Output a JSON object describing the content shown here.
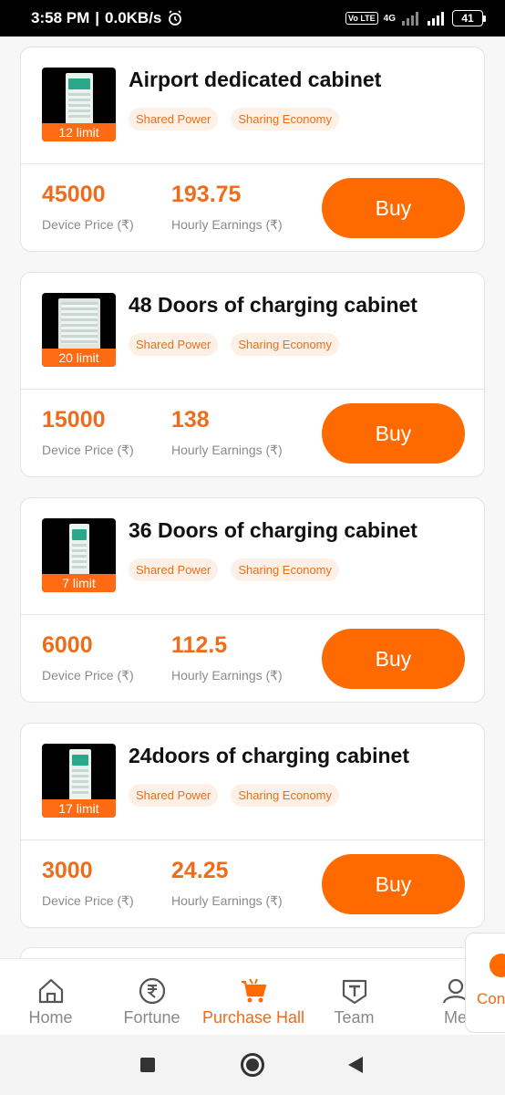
{
  "status_bar": {
    "time": "3:58 PM",
    "net_speed": "0.0KB/s",
    "volte": "Vo LTE",
    "network": "4G",
    "battery": "41"
  },
  "products": [
    {
      "limit": "12 limit",
      "title": "Airport dedicated cabinet",
      "tags": [
        "Shared Power",
        "Sharing Economy"
      ],
      "price": "45000",
      "price_label": "Device Price (₹)",
      "earnings": "193.75",
      "earnings_label": "Hourly Earnings (₹)",
      "buy_label": "Buy"
    },
    {
      "limit": "20 limit",
      "title": "48 Doors of charging cabinet",
      "tags": [
        "Shared Power",
        "Sharing Economy"
      ],
      "price": "15000",
      "price_label": "Device Price (₹)",
      "earnings": "138",
      "earnings_label": "Hourly Earnings (₹)",
      "buy_label": "Buy"
    },
    {
      "limit": "7 limit",
      "title": "36 Doors of charging cabinet",
      "tags": [
        "Shared Power",
        "Sharing Economy"
      ],
      "price": "6000",
      "price_label": "Device Price (₹)",
      "earnings": "112.5",
      "earnings_label": "Hourly Earnings (₹)",
      "buy_label": "Buy"
    },
    {
      "limit": "17 limit",
      "title": "24doors of charging cabinet",
      "tags": [
        "Shared Power",
        "Sharing Economy"
      ],
      "price": "3000",
      "price_label": "Device Price (₹)",
      "earnings": "24.25",
      "earnings_label": "Hourly Earnings (₹)",
      "buy_label": "Buy"
    }
  ],
  "tabs": [
    {
      "label": "Home",
      "icon": "home-icon",
      "active": false
    },
    {
      "label": "Fortune",
      "icon": "rupee-icon",
      "active": false
    },
    {
      "label": "Purchase Hall",
      "icon": "cart-icon",
      "active": true
    },
    {
      "label": "Team",
      "icon": "team-icon",
      "active": false
    },
    {
      "label": "Me",
      "icon": "user-icon",
      "active": false
    }
  ],
  "contact": {
    "label": "Cont"
  },
  "colors": {
    "accent": "#ff6a00",
    "accent_text": "#ef6d1a",
    "tag_bg": "#fdf0e6"
  }
}
